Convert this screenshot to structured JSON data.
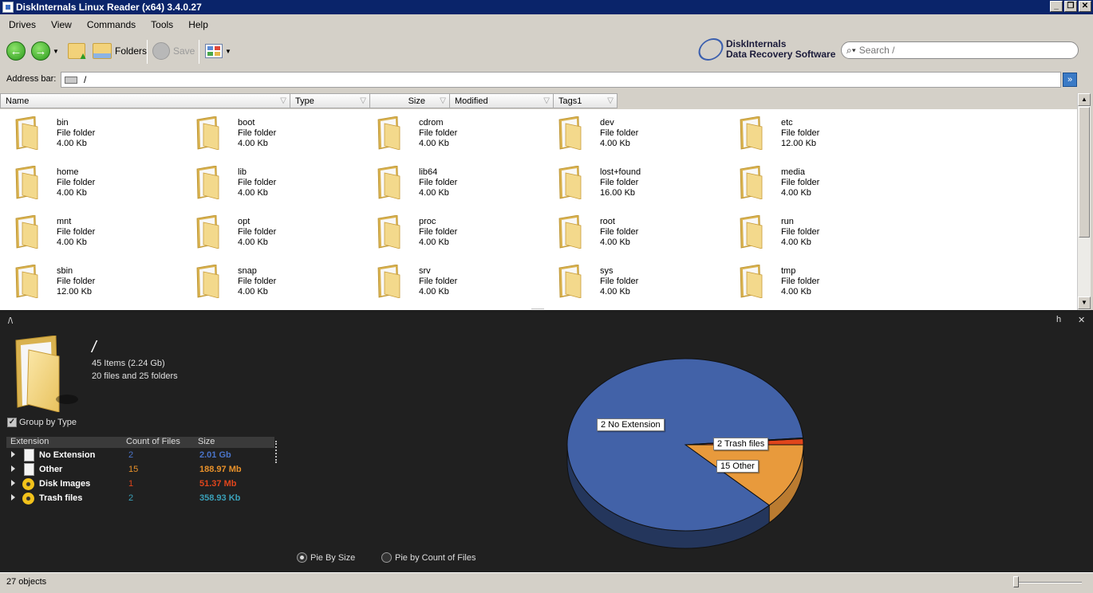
{
  "window": {
    "title": "DiskInternals Linux Reader (x64) 3.4.0.27"
  },
  "menu": [
    "Drives",
    "View",
    "Commands",
    "Tools",
    "Help"
  ],
  "toolbar": {
    "back_icon": "back-arrow-icon",
    "forward_icon": "forward-arrow-icon",
    "folders_label": "Folders",
    "save_label": "Save",
    "brand_line1": "DiskInternals",
    "brand_line2": "Data Recovery Software",
    "search_placeholder": "Search /"
  },
  "address": {
    "label": "Address bar:",
    "value": "/"
  },
  "columns": [
    "Name",
    "Type",
    "Size",
    "Modified",
    "Tags1"
  ],
  "files": [
    {
      "name": "bin",
      "type": "File folder",
      "size": "4.00 Kb"
    },
    {
      "name": "boot",
      "type": "File folder",
      "size": "4.00 Kb"
    },
    {
      "name": "cdrom",
      "type": "File folder",
      "size": "4.00 Kb"
    },
    {
      "name": "dev",
      "type": "File folder",
      "size": "4.00 Kb"
    },
    {
      "name": "etc",
      "type": "File folder",
      "size": "12.00 Kb"
    },
    {
      "name": "home",
      "type": "File folder",
      "size": "4.00 Kb"
    },
    {
      "name": "lib",
      "type": "File folder",
      "size": "4.00 Kb"
    },
    {
      "name": "lib64",
      "type": "File folder",
      "size": "4.00 Kb"
    },
    {
      "name": "lost+found",
      "type": "File folder",
      "size": "16.00 Kb"
    },
    {
      "name": "media",
      "type": "File folder",
      "size": "4.00 Kb"
    },
    {
      "name": "mnt",
      "type": "File folder",
      "size": "4.00 Kb"
    },
    {
      "name": "opt",
      "type": "File folder",
      "size": "4.00 Kb"
    },
    {
      "name": "proc",
      "type": "File folder",
      "size": "4.00 Kb"
    },
    {
      "name": "root",
      "type": "File folder",
      "size": "4.00 Kb"
    },
    {
      "name": "run",
      "type": "File folder",
      "size": "4.00 Kb"
    },
    {
      "name": "sbin",
      "type": "File folder",
      "size": "12.00 Kb"
    },
    {
      "name": "snap",
      "type": "File folder",
      "size": "4.00 Kb"
    },
    {
      "name": "srv",
      "type": "File folder",
      "size": "4.00 Kb"
    },
    {
      "name": "sys",
      "type": "File folder",
      "size": "4.00 Kb"
    },
    {
      "name": "tmp",
      "type": "File folder",
      "size": "4.00 Kb"
    }
  ],
  "details": {
    "path": "/\\",
    "h_button": "h",
    "close_button": "✕",
    "title": "/",
    "items": "45 Items (2.24 Gb)",
    "counts": "20 files and 25 folders",
    "group_by_type": "Group by Type",
    "group_by_type_checked": true,
    "table_headers": [
      "Extension",
      "Count of Files",
      "Size"
    ],
    "extensions": [
      {
        "name": "No Extension",
        "count": "2",
        "size": "2.01 Gb",
        "icon": "document-icon",
        "color": "#4a74c9"
      },
      {
        "name": "Other",
        "count": "15",
        "size": "188.97 Mb",
        "icon": "document-icon",
        "color": "#e8912a"
      },
      {
        "name": "Disk Images",
        "count": "1",
        "size": "51.37 Mb",
        "icon": "disc-icon",
        "color": "#e0451c"
      },
      {
        "name": "Trash files",
        "count": "2",
        "size": "358.93 Kb",
        "icon": "disc-icon",
        "color": "#3aa0b8"
      }
    ],
    "pie_labels": [
      "2 No Extension",
      "15 Other",
      "2 Trash files"
    ],
    "pie_options": [
      "Pie By Size",
      "Pie by Count of Files"
    ],
    "pie_selected": "Pie By Size"
  },
  "pie_colors": {
    "no_extension": "#4262a8",
    "other": "#e89a3c",
    "disk_images": "#e0451c",
    "trash": "#3aa0b8"
  },
  "status": {
    "text": "27 objects"
  }
}
